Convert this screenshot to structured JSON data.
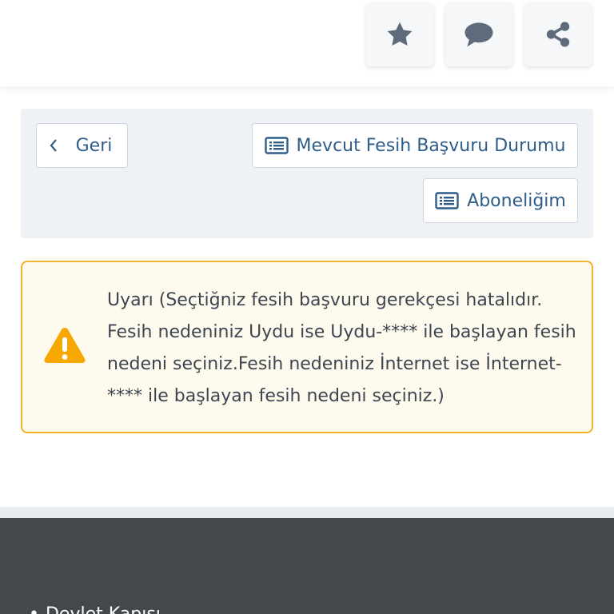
{
  "actions": {
    "favorite_icon": "star-icon",
    "comment_icon": "comment-icon",
    "share_icon": "share-icon"
  },
  "nav": {
    "back_label": "Geri",
    "status_label": "Mevcut Fesih Başvuru Durumu",
    "subscription_label": "Aboneliğim"
  },
  "warning": {
    "message": "Uyarı (Seçtiğniz fesih başvuru gerekçesi hatalıdır. Fesih nedeniniz Uydu ise Uydu-**** ile başlayan fesih nedeni seçiniz.Fesih nedeniniz İnternet ise İnternet-**** ile başlayan fesih nedeni seçiniz.)"
  },
  "footer": {
    "link_label": "Devlet Kapısı"
  },
  "colors": {
    "accent": "#2f5d8a",
    "warning_border": "#f0b429",
    "warning_icon": "#f6a800",
    "icon_gray": "#5d6b7a",
    "footer_bg": "#45484b"
  }
}
